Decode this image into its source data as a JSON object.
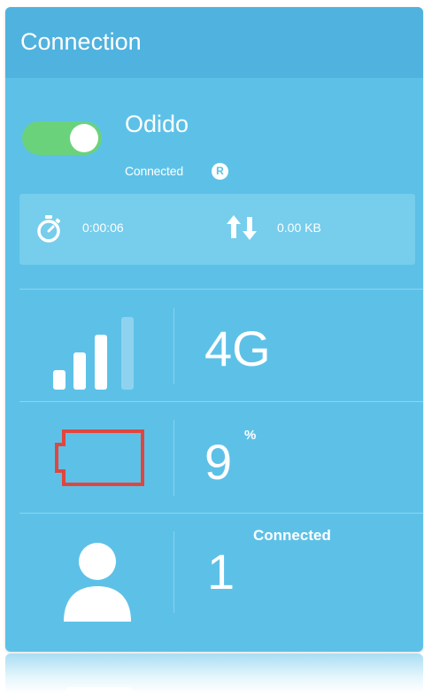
{
  "card": {
    "title": "Connection"
  },
  "connection": {
    "toggle_state": "on",
    "isp": "Odido",
    "status": "Connected",
    "roaming_badge": "R"
  },
  "stats": {
    "duration": "0:00:06",
    "data_usage": "0.00 KB",
    "icons": [
      "stopwatch-icon",
      "upload-download-icon"
    ]
  },
  "network": {
    "type": "4G",
    "signal_bars_filled": 3,
    "signal_bars_total": 4
  },
  "battery": {
    "value": "9",
    "unit": "%",
    "level_color": "#e0463f"
  },
  "clients": {
    "label": "Connected",
    "count": "1"
  },
  "colors": {
    "card_bg": "#5dc1e7",
    "header_bg": "#50b2de",
    "toggle_on": "#6bd27c",
    "battery_low": "#e0463f"
  }
}
